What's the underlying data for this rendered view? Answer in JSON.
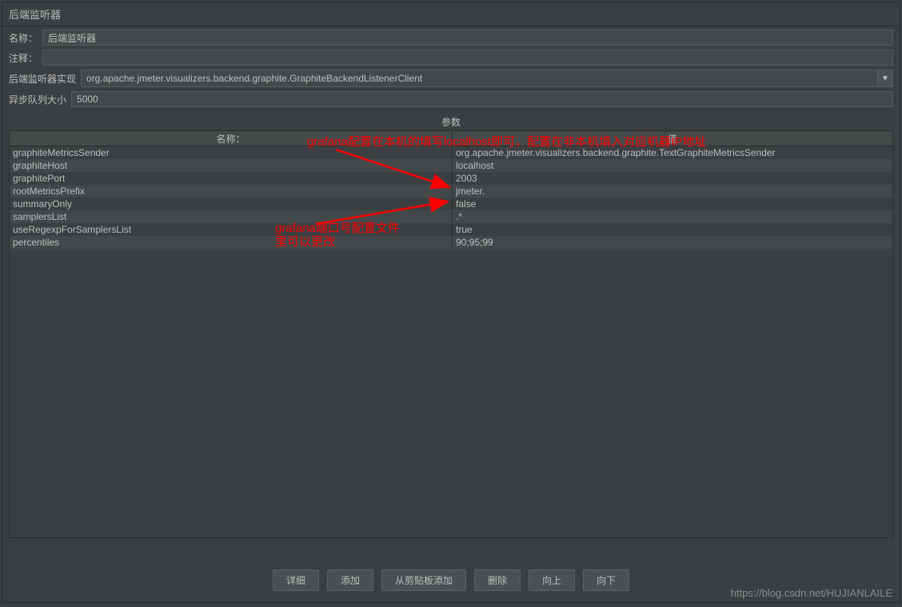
{
  "panel": {
    "title": "后端监听器"
  },
  "form": {
    "name_label": "名称：",
    "name_value": "后端监听器",
    "comment_label": "注释：",
    "comment_value": "",
    "impl_label": "后端监听器实现",
    "impl_value": "org.apache.jmeter.visualizers.backend.graphite.GraphiteBackendListenerClient",
    "queue_label": "异步队列大小",
    "queue_value": "5000"
  },
  "section_label": "参数",
  "table": {
    "col_name": "名称：",
    "col_value": "值",
    "rows": [
      {
        "name": "graphiteMetricsSender",
        "value": "org.apache.jmeter.visualizers.backend.graphite.TextGraphiteMetricsSender"
      },
      {
        "name": "graphiteHost",
        "value": "localhost"
      },
      {
        "name": "graphitePort",
        "value": "2003"
      },
      {
        "name": "rootMetricsPrefix",
        "value": "jmeter."
      },
      {
        "name": "summaryOnly",
        "value": "false"
      },
      {
        "name": "samplersList",
        "value": ".*"
      },
      {
        "name": "useRegexpForSamplersList",
        "value": "true"
      },
      {
        "name": "percentiles",
        "value": "90;95;99"
      }
    ]
  },
  "buttons": {
    "detail": "详细",
    "add": "添加",
    "add_clipboard": "从剪贴板添加",
    "delete": "删除",
    "up": "向上",
    "down": "向下"
  },
  "annotations": {
    "a1": "grafana配置在本机的填写localhost即可，配置在非本机填入对应机器IP地址",
    "a2_line1": "grafana端口号配置文件",
    "a2_line2": "里可以更改"
  },
  "watermark": "https://blog.csdn.net/HUJIANLAILE",
  "combo_icon": "▼"
}
